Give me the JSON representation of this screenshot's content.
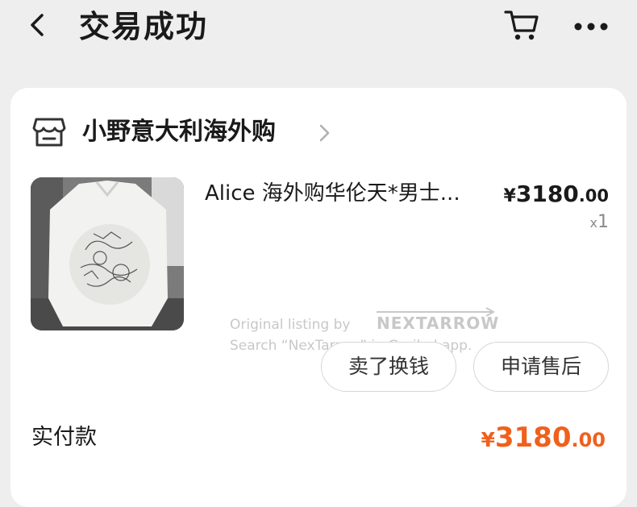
{
  "header": {
    "title": "交易成功",
    "icons": [
      "chevron-left-icon",
      "cart-icon",
      "more-icon"
    ]
  },
  "shop": {
    "name": "小野意大利海外购",
    "icon": "storefront-icon"
  },
  "product": {
    "title": "Alice 海外购华伦天*男士...",
    "price_currency": "¥",
    "price_int": "3180",
    "price_dec": ".00",
    "qty_prefix": "x",
    "qty_value": "1"
  },
  "watermark": {
    "line1": "Original listing by",
    "brand": "NEXTARROW",
    "line2": "Search “NexTarrow” in Grailed app."
  },
  "actions": {
    "sell_label": "卖了换钱",
    "after_sale_label": "申请售后"
  },
  "payment": {
    "label": "实付款",
    "currency": "¥",
    "amount_int": "3180",
    "amount_dec": ".00"
  },
  "colors": {
    "accent": "#f0601c",
    "background": "#eeeeee",
    "card": "#ffffff"
  }
}
